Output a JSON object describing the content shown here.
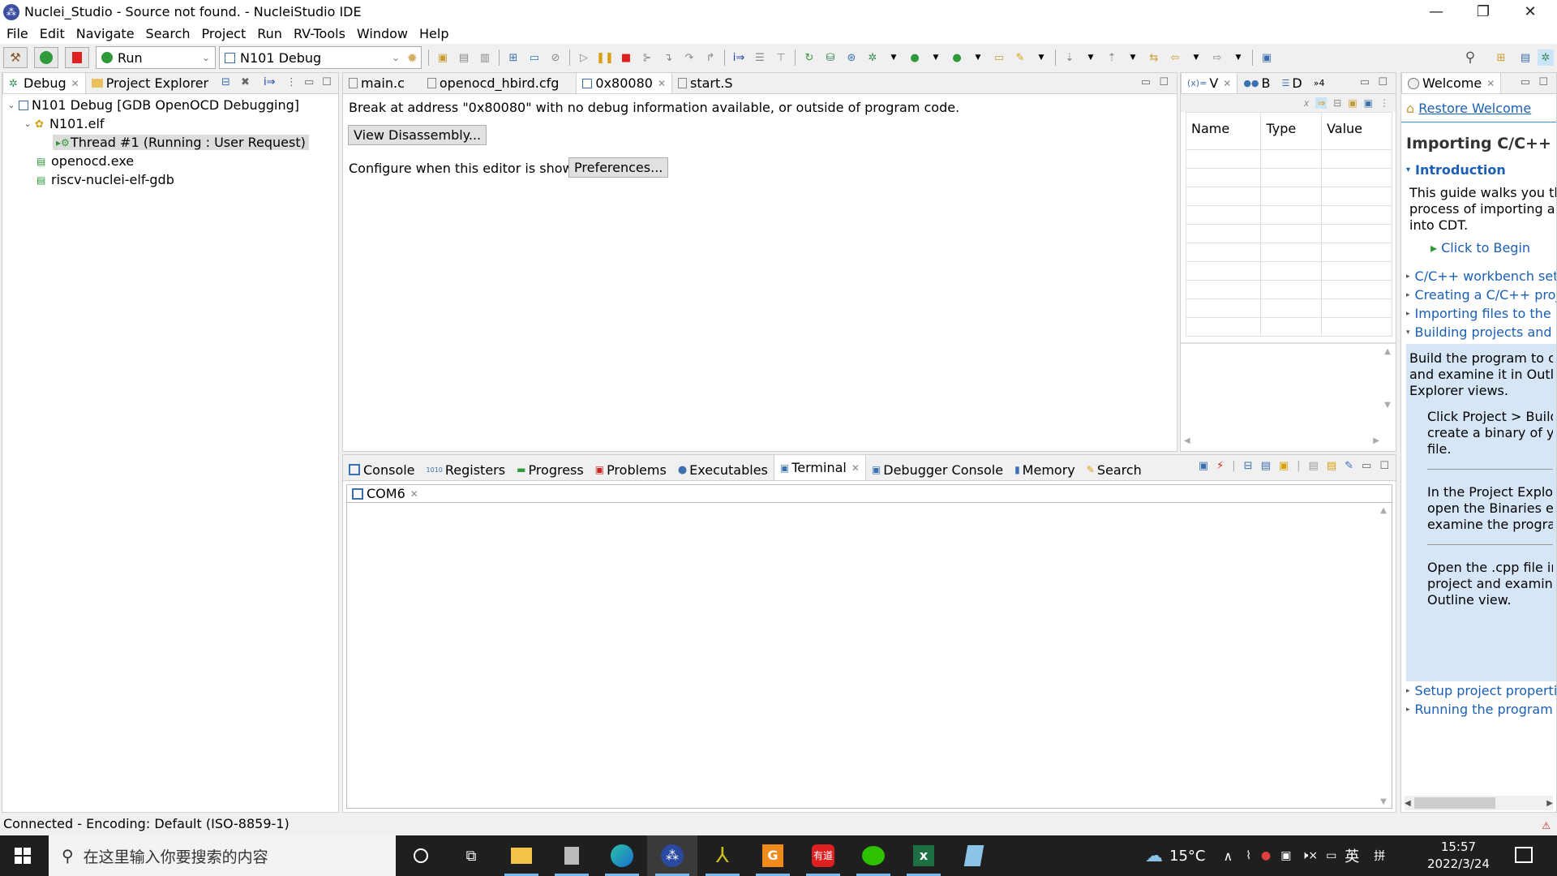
{
  "window": {
    "title": "Nuclei_Studio - Source not found. - NucleiStudio IDE",
    "controls": {
      "minimize": "—",
      "restore": "❐",
      "close": "✕"
    }
  },
  "menu": [
    "File",
    "Edit",
    "Navigate",
    "Search",
    "Project",
    "Run",
    "RV-Tools",
    "Window",
    "Help"
  ],
  "toolbar": {
    "run_mode": "Run",
    "launch_config": "N101 Debug"
  },
  "debug_view": {
    "tabs": [
      {
        "label": "Debug",
        "icon": "bug-icon",
        "active": true
      },
      {
        "label": "Project Explorer",
        "icon": "folder-icon",
        "active": false
      }
    ],
    "tree": [
      {
        "label": "N101 Debug [GDB OpenOCD Debugging]",
        "level": 0,
        "expanded": true
      },
      {
        "label": "N101.elf",
        "level": 1,
        "expanded": true
      },
      {
        "label": "Thread #1 (Running : User Request)",
        "level": 2,
        "selected": true
      },
      {
        "label": "openocd.exe",
        "level": 1
      },
      {
        "label": "riscv-nuclei-elf-gdb",
        "level": 1
      }
    ]
  },
  "editor": {
    "tabs": [
      {
        "label": "main.c"
      },
      {
        "label": "openocd_hbird.cfg"
      },
      {
        "label": "0x80080",
        "active": true
      },
      {
        "label": "start.S"
      }
    ],
    "message": "Break at address \"0x80080\" with no debug information available, or outside of program code.",
    "view_disassembly": "View Disassembly...",
    "configure_text": "Configure when this editor is shown",
    "preferences": "Preferences..."
  },
  "variables_view": {
    "tabs": [
      {
        "label": "V",
        "icon": "variables-icon",
        "active": true
      },
      {
        "label": "B",
        "icon": "breakpoints-icon"
      },
      {
        "label": "D",
        "icon": "disassembly-icon"
      },
      {
        "label": "4",
        "icon": "overflow-icon"
      }
    ],
    "columns": [
      "Name",
      "Type",
      "Value"
    ]
  },
  "welcome": {
    "tab": "Welcome",
    "restore": "Restore Welcome",
    "heading": "Importing C/C++ Pr",
    "intro_title": "Introduction",
    "intro_lines": [
      "This guide walks you thou",
      "process of importing a C,",
      "into CDT."
    ],
    "click_begin": "Click to Begin",
    "sections": [
      "C/C++ workbench setup",
      "Creating a C/C++ proje",
      "Importing files to the pr",
      "Building projects and in"
    ],
    "build_lines": [
      "Build the program to cre",
      "and examine it in Outline",
      "Explorer views."
    ],
    "steps": [
      [
        "Click Project > Build A",
        "create a binary of you",
        "file."
      ],
      [
        "In the Project Explorer",
        "open the Binaries eler",
        "examine the program"
      ],
      [
        "Open the .cpp file in t",
        "project and examine t",
        "Outline view."
      ]
    ],
    "sections_after": [
      "Setup project propertie",
      "Running the program"
    ]
  },
  "bottom": {
    "tabs": [
      {
        "label": "Console"
      },
      {
        "label": "Registers"
      },
      {
        "label": "Progress"
      },
      {
        "label": "Problems"
      },
      {
        "label": "Executables"
      },
      {
        "label": "Terminal",
        "active": true
      },
      {
        "label": "Debugger Console"
      },
      {
        "label": "Memory"
      },
      {
        "label": "Search"
      }
    ],
    "terminal_tab": "COM6"
  },
  "status": "Connected - Encoding: Default (ISO-8859-1)",
  "taskbar": {
    "search_placeholder": "在这里输入你要搜索的内容",
    "weather": "15°C",
    "ime1": "英",
    "ime2": "拼",
    "time": "15:57",
    "date": "2022/3/24"
  }
}
